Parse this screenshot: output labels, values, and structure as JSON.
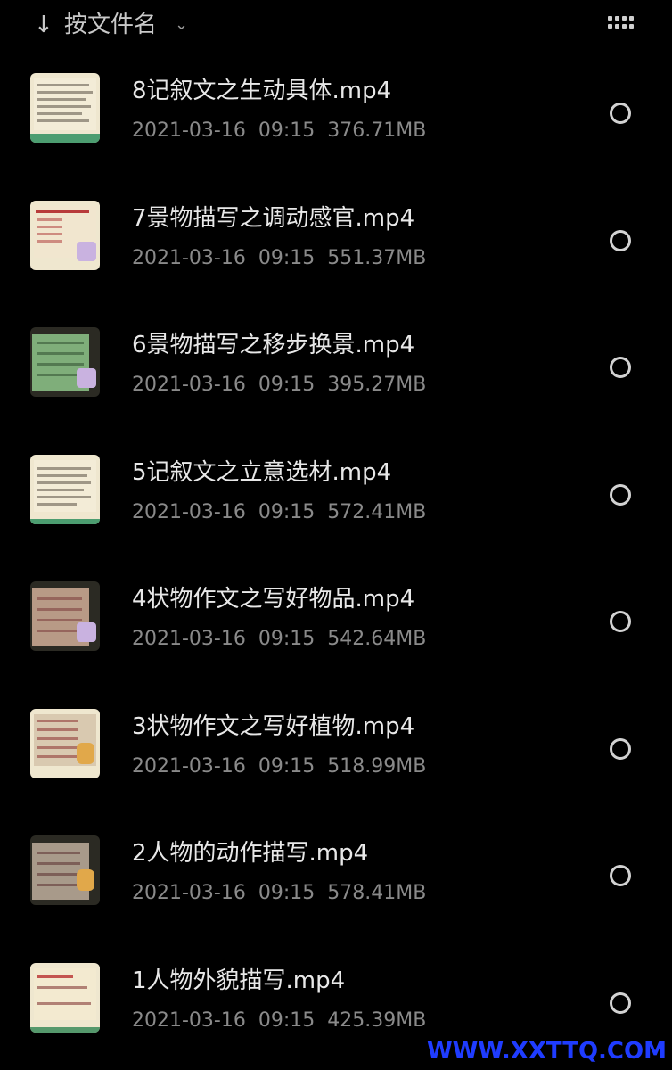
{
  "header": {
    "sort_label": "按文件名",
    "sort_icon": "arrow-down-icon",
    "chevron_icon": "chevron-down-icon",
    "view_icon": "grid-view-icon"
  },
  "files": [
    {
      "name": "8记叙文之生动具体.mp4",
      "date": "2021-03-16",
      "time": "09:15",
      "size": "376.71MB"
    },
    {
      "name": "7景物描写之调动感官.mp4",
      "date": "2021-03-16",
      "time": "09:15",
      "size": "551.37MB"
    },
    {
      "name": "6景物描写之移步换景.mp4",
      "date": "2021-03-16",
      "time": "09:15",
      "size": "395.27MB"
    },
    {
      "name": "5记叙文之立意选材.mp4",
      "date": "2021-03-16",
      "time": "09:15",
      "size": "572.41MB"
    },
    {
      "name": "4状物作文之写好物品.mp4",
      "date": "2021-03-16",
      "time": "09:15",
      "size": "542.64MB"
    },
    {
      "name": "3状物作文之写好植物.mp4",
      "date": "2021-03-16",
      "time": "09:15",
      "size": "518.99MB"
    },
    {
      "name": "2人物的动作描写.mp4",
      "date": "2021-03-16",
      "time": "09:15",
      "size": "578.41MB"
    },
    {
      "name": "1人物外貌描写.mp4",
      "date": "2021-03-16",
      "time": "09:15",
      "size": "425.39MB"
    }
  ],
  "watermark": "WWW.XXTTQ.COM"
}
